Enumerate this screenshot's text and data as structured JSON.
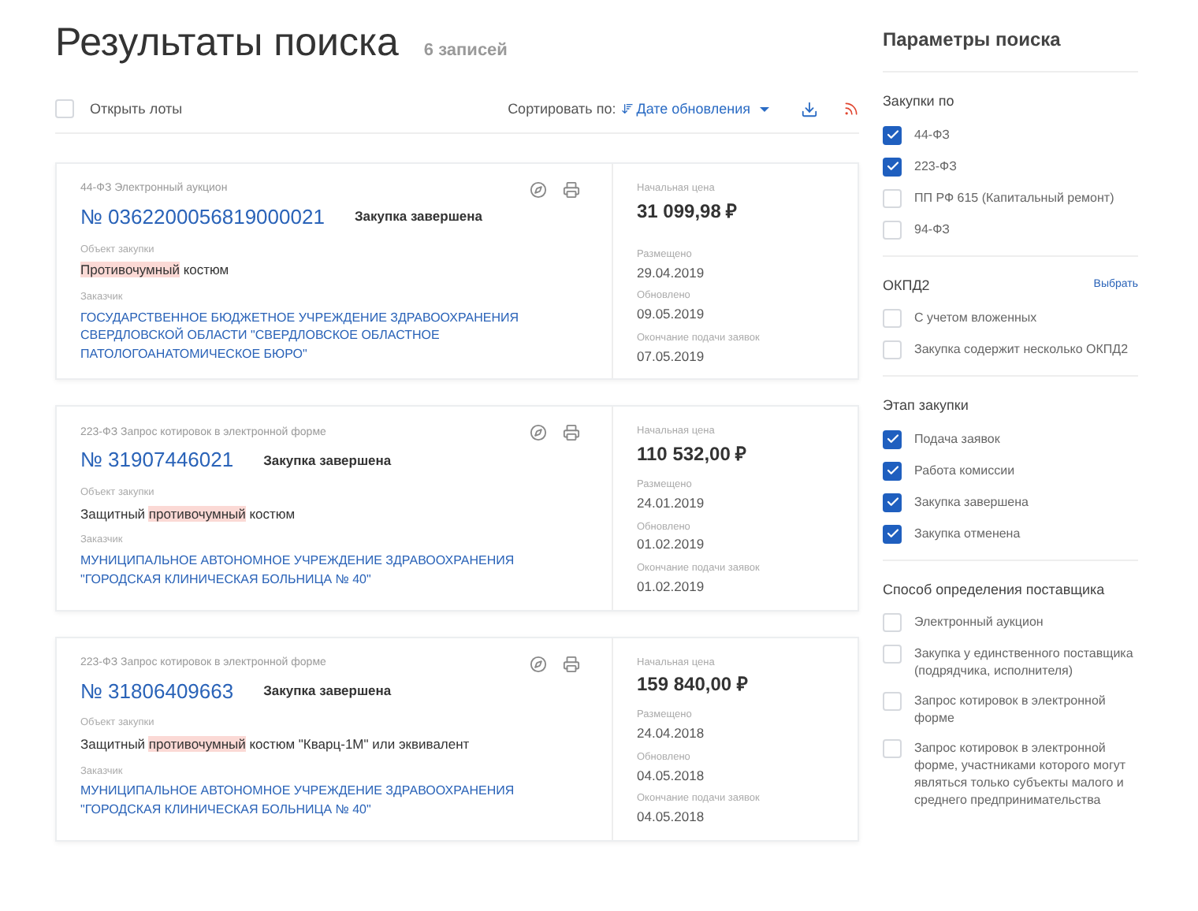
{
  "header": {
    "title": "Результаты поиска",
    "count": "6 записей"
  },
  "toolbar": {
    "open_lots": {
      "label": "Открыть лоты",
      "checked": false
    },
    "sort_label": "Сортировать по:",
    "sort_value": "Дате обновления"
  },
  "results": [
    {
      "type": "44-ФЗ Электронный аукцион",
      "number": "№ 0362200056819000021",
      "status": "Закупка завершена",
      "object_label": "Объект закупки",
      "object": [
        {
          "text": "Противочумный",
          "highlight": true
        },
        {
          "text": " костюм",
          "highlight": false
        }
      ],
      "customer_label": "Заказчик",
      "customer": "ГОСУДАРСТВЕННОЕ БЮДЖЕТНОЕ УЧРЕЖДЕНИЕ ЗДРАВООХРАНЕНИЯ СВЕРДЛОВСКОЙ ОБЛАСТИ \"СВЕРДЛОВСКОЕ ОБЛАСТНОЕ ПАТОЛОГОАНАТОМИЧЕСКОЕ БЮРО\"",
      "price_label": "Начальная цена",
      "price": "31 099,98 ₽",
      "dates": [
        {
          "label": "Размещено",
          "value": "29.04.2019"
        },
        {
          "label": "Обновлено",
          "value": "09.05.2019"
        },
        {
          "label": "Окончание подачи заявок",
          "value": "07.05.2019"
        }
      ]
    },
    {
      "type": "223-ФЗ Запрос котировок в электронной форме",
      "number": "№ 31907446021",
      "status": "Закупка завершена",
      "object_label": "Объект закупки",
      "object": [
        {
          "text": "Защитный ",
          "highlight": false
        },
        {
          "text": "противочумный",
          "highlight": true
        },
        {
          "text": " костюм",
          "highlight": false
        }
      ],
      "customer_label": "Заказчик",
      "customer": "МУНИЦИПАЛЬНОЕ АВТОНОМНОЕ УЧРЕЖДЕНИЕ ЗДРАВООХРАНЕНИЯ \"ГОРОДСКАЯ КЛИНИЧЕСКАЯ БОЛЬНИЦА № 40\"",
      "price_label": "Начальная цена",
      "price": "110 532,00 ₽",
      "dates": [
        {
          "label": "Размещено",
          "value": "24.01.2019"
        },
        {
          "label": "Обновлено",
          "value": "01.02.2019"
        },
        {
          "label": "Окончание подачи заявок",
          "value": "01.02.2019"
        }
      ]
    },
    {
      "type": "223-ФЗ Запрос котировок в электронной форме",
      "number": "№ 31806409663",
      "status": "Закупка завершена",
      "object_label": "Объект закупки",
      "object": [
        {
          "text": "Защитный ",
          "highlight": false
        },
        {
          "text": "противочумный",
          "highlight": true
        },
        {
          "text": " костюм \"Кварц-1М\" или эквивалент",
          "highlight": false
        }
      ],
      "customer_label": "Заказчик",
      "customer": "МУНИЦИПАЛЬНОЕ АВТОНОМНОЕ УЧРЕЖДЕНИЕ ЗДРАВООХРАНЕНИЯ \"ГОРОДСКАЯ КЛИНИЧЕСКАЯ БОЛЬНИЦА № 40\"",
      "price_label": "Начальная цена",
      "price": "159 840,00 ₽",
      "dates": [
        {
          "label": "Размещено",
          "value": "24.04.2018"
        },
        {
          "label": "Обновлено",
          "value": "04.05.2018"
        },
        {
          "label": "Окончание подачи заявок",
          "value": "04.05.2018"
        }
      ]
    }
  ],
  "sidebar": {
    "title": "Параметры поиска",
    "sections": [
      {
        "title": "Закупки по",
        "options": [
          {
            "label": "44-ФЗ",
            "checked": true
          },
          {
            "label": "223-ФЗ",
            "checked": true
          },
          {
            "label": "ПП РФ 615 (Капитальный ремонт)",
            "checked": false
          },
          {
            "label": "94-ФЗ",
            "checked": false
          }
        ]
      },
      {
        "title": "ОКПД2",
        "action": "Выбрать",
        "options": [
          {
            "label": "С учетом вложенных",
            "checked": false
          },
          {
            "label": "Закупка содержит несколько ОКПД2",
            "checked": false
          }
        ]
      },
      {
        "title": "Этап закупки",
        "options": [
          {
            "label": "Подача заявок",
            "checked": true
          },
          {
            "label": "Работа комиссии",
            "checked": true
          },
          {
            "label": "Закупка завершена",
            "checked": true
          },
          {
            "label": "Закупка отменена",
            "checked": true
          }
        ]
      },
      {
        "title": "Способ определения поставщика",
        "options": [
          {
            "label": "Электронный аукцион",
            "checked": false
          },
          {
            "label": "Закупка у единственного поставщика (подрядчика, исполнителя)",
            "checked": false
          },
          {
            "label": "Запрос котировок в электронной форме",
            "checked": false
          },
          {
            "label": "Запрос котировок в электронной форме, участниками которого могут являться только субъекты малого и среднего предпринимательства",
            "checked": false
          }
        ]
      }
    ]
  }
}
